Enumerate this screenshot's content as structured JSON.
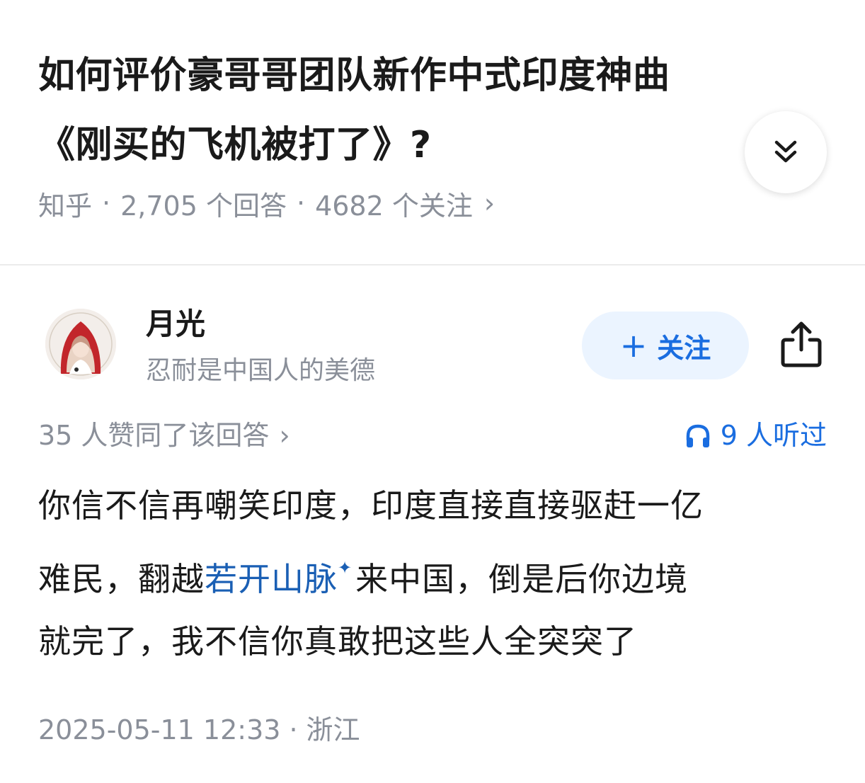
{
  "question": {
    "title_line1": "如何评价豪哥哥团队新作中式印度神曲",
    "title_line2": "《刚买的飞机被打了》?",
    "source": "知乎",
    "answers": "2,705 个回答",
    "followers": "4682 个关注",
    "separator": "·",
    "chevron": "›"
  },
  "author": {
    "name": "月光",
    "bio": "忍耐是中国人的美德",
    "follow_plus": "+",
    "follow_label": "关注"
  },
  "stats": {
    "votes": "35 人赞同了该回答",
    "chevron": "›",
    "listened": "9 人听过"
  },
  "answer": {
    "line1": "你信不信再嘲笑印度，印度直接直接驱赶一亿",
    "line2_before": "难民，翻越",
    "line2_keyword": "若开山脉",
    "line2_spark": "✦",
    "line2_after": "来中国，倒是后你边境",
    "line3": "就完了，我不信你真敢把这些人全突突了"
  },
  "footer": {
    "datetime": "2025-05-11 12:33",
    "separator": "·",
    "location": "浙江"
  },
  "icons": {
    "expand": "chevrons-down-icon",
    "share": "share-icon",
    "headphones": "headphones-icon",
    "avatar": "avatar-illustration"
  },
  "colors": {
    "accent": "#1a6de0",
    "follow_bg": "#ebf4ff",
    "muted": "#8a8f99",
    "text": "#1a1a1a"
  }
}
